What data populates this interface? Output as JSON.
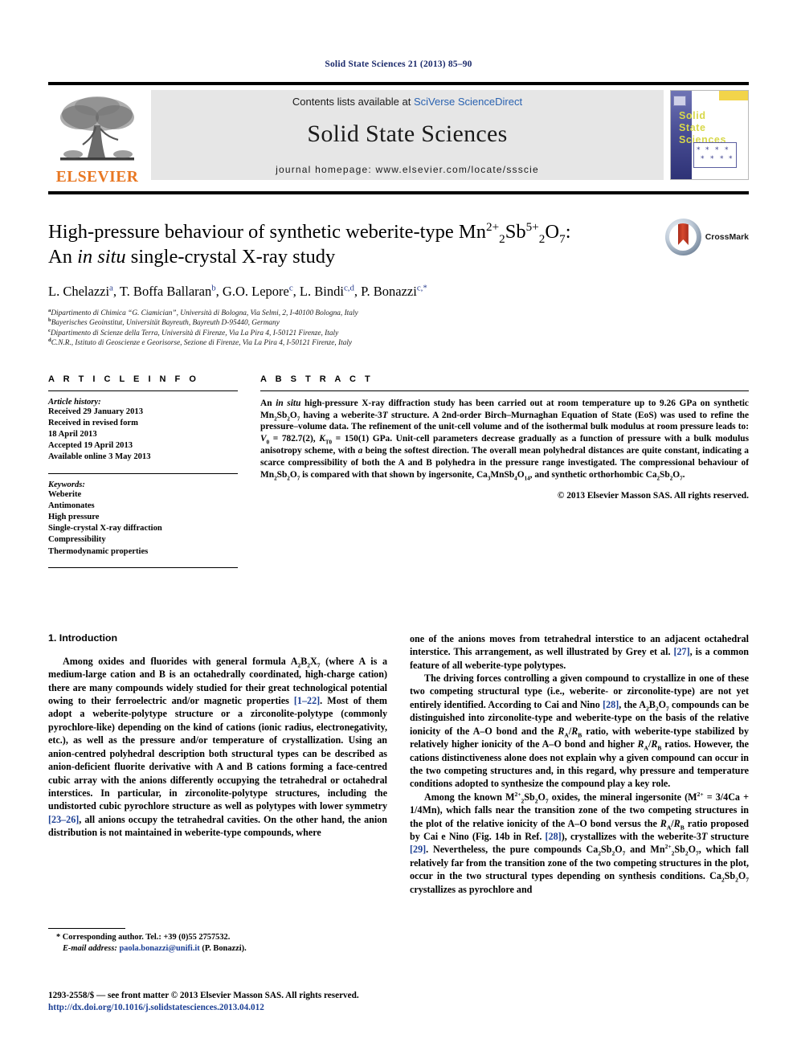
{
  "running_head": "Solid State Sciences 21 (2013) 85–90",
  "header": {
    "contents_prefix": "Contents lists available at ",
    "contents_link": "SciVerse ScienceDirect",
    "journal_name": "Solid State Sciences",
    "homepage": "journal homepage: www.elsevier.com/locate/ssscie",
    "publisher_logo_text": "ELSEVIER",
    "cover_title_lines": [
      "Solid",
      "State",
      "Sciences"
    ]
  },
  "article": {
    "title_line1_a": "High-pressure behaviour of synthetic weberite-type Mn",
    "title_line1_sup1": "2+",
    "title_line1_sub1": "2",
    "title_line1_b": "Sb",
    "title_line1_sup2": "5+",
    "title_line1_sub2": "2",
    "title_line1_c": "O",
    "title_line1_sub3": "7",
    "title_line1_d": ":",
    "title_line2_a": "An ",
    "title_line2_it": "in situ",
    "title_line2_b": " single-crystal X-ray study",
    "crossmark_label": "CrossMark",
    "authors": [
      {
        "name": "L. Chelazzi",
        "sup": "a"
      },
      {
        "name": "T. Boffa Ballaran",
        "sup": "b"
      },
      {
        "name": "G.O. Lepore",
        "sup": "c"
      },
      {
        "name": "L. Bindi",
        "sup": "c,d"
      },
      {
        "name": "P. Bonazzi",
        "sup": "c,*"
      }
    ],
    "affiliations": [
      {
        "mark": "a",
        "text": "Dipartimento di Chimica “G. Ciamician”, Università di Bologna, Via Selmi, 2, I-40100 Bologna, Italy"
      },
      {
        "mark": "b",
        "text": "Bayerisches Geoinstitut, Universität Bayreuth, Bayreuth D-95440, Germany"
      },
      {
        "mark": "c",
        "text": "Dipartimento di Scienze della Terra, Università di Firenze, Via La Pira 4, I-50121 Firenze, Italy"
      },
      {
        "mark": "d",
        "text": "C.N.R., Istituto di Geoscienze e Georisorse, Sezione di Firenze, Via La Pira 4, I-50121 Firenze, Italy"
      }
    ]
  },
  "article_info": {
    "heading": "A R T I C L E  I N F O",
    "history_label": "Article history:",
    "history_lines": [
      "Received 29 January 2013",
      "Received in revised form",
      "18 April 2013",
      "Accepted 19 April 2013",
      "Available online 3 May 2013"
    ],
    "keywords_label": "Keywords:",
    "keywords": [
      "Weberite",
      "Antimonates",
      "High pressure",
      "Single-crystal X-ray diffraction",
      "Compressibility",
      "Thermodynamic properties"
    ]
  },
  "abstract": {
    "heading": "A B S T R A C T",
    "copyright": "© 2013 Elsevier Masson SAS. All rights reserved."
  },
  "intro": {
    "heading": "1.  Introduction"
  },
  "footnote": {
    "corresponding": "* Corresponding author. Tel.: +39 (0)55 2757532.",
    "email_label": "E-mail address:",
    "email": "paola.bonazzi@unifi.it",
    "email_owner": "(P. Bonazzi)."
  },
  "page_footer": {
    "front_matter": "1293-2558/$ — see front matter © 2013 Elsevier Masson SAS. All rights reserved.",
    "doi": "http://dx.doi.org/10.1016/j.solidstatesciences.2013.04.012"
  }
}
